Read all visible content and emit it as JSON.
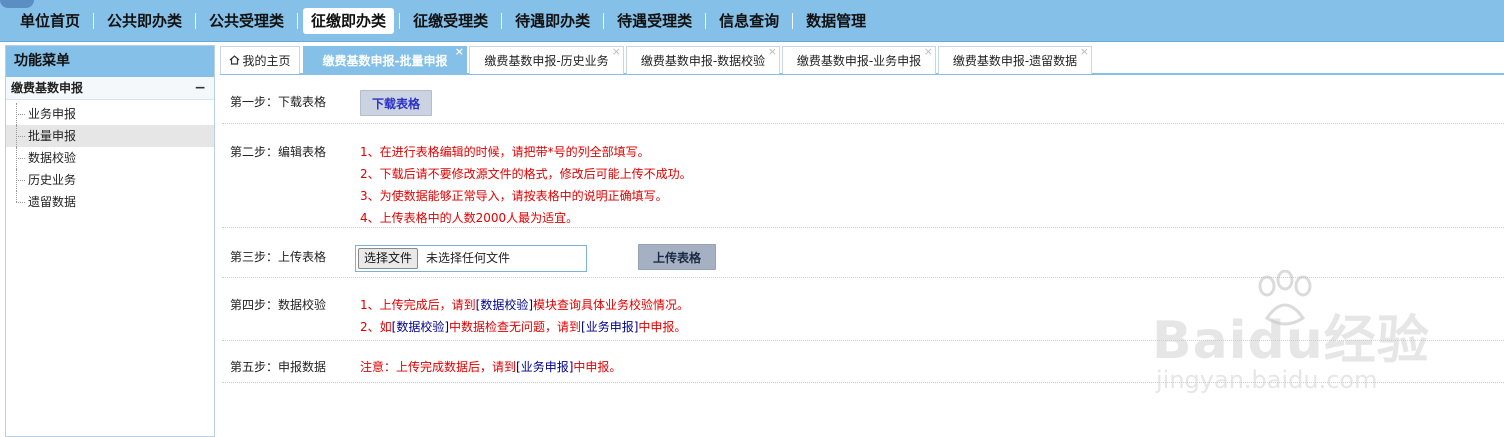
{
  "topnav": {
    "items": [
      "单位首页",
      "公共即办类",
      "公共受理类",
      "征缴即办类",
      "征缴受理类",
      "待遇即办类",
      "待遇受理类",
      "信息查询",
      "数据管理"
    ],
    "active_index": 3
  },
  "sidebar": {
    "title": "功能菜单",
    "group": {
      "label": "缴费基数申报",
      "toggle": "−"
    },
    "items": [
      "业务申报",
      "批量申报",
      "数据校验",
      "历史业务",
      "遗留数据"
    ],
    "active_index": 1
  },
  "tabs": {
    "home": {
      "icon": "home-icon",
      "label": "我的主页"
    },
    "items": [
      "缴费基数申报-批量申报",
      "缴费基数申报-历史业务",
      "缴费基数申报-数据校验",
      "缴费基数申报-业务申报",
      "缴费基数申报-遗留数据"
    ],
    "active_index": 0,
    "close_glyph": "×"
  },
  "steps": {
    "step1": {
      "label": "第一步：下载表格",
      "button": "下载表格"
    },
    "step2": {
      "label": "第二步：编辑表格",
      "notes": [
        "1、在进行表格编辑的时候，请把带*号的列全部填写。",
        "2、下载后请不要修改源文件的格式，修改后可能上传不成功。",
        "3、为使数据能够正常导入，请按表格中的说明正确填写。",
        "4、上传表格中的人数2000人最为适宜。"
      ]
    },
    "step3": {
      "label": "第三步：上传表格",
      "file_button": "选择文件",
      "file_status": "未选择任何文件",
      "button": "上传表格"
    },
    "step4": {
      "label": "第四步：数据校验",
      "note1": {
        "pre": "1、上传完成后，请到",
        "link": "[数据校验]",
        "post": "模块查询具体业务校验情况。"
      },
      "note2": {
        "pre": "2、如",
        "link1": "[数据校验]",
        "mid": "中数据检查无问题，请到",
        "link2": "[业务申报]",
        "post": "中申报。"
      }
    },
    "step5": {
      "label": "第五步：申报数据",
      "note": {
        "pre": "注意：上传完成数据后，请到",
        "link": "[业务申报]",
        "post": "中申报。"
      }
    }
  },
  "watermark": {
    "brand": "Baidu经验",
    "url": "jingyan.baidu.com"
  },
  "colors": {
    "nav_bg": "#84c0e8",
    "note_red": "#e00000",
    "link_blue": "#00008b",
    "download_text": "#2b30c8"
  }
}
